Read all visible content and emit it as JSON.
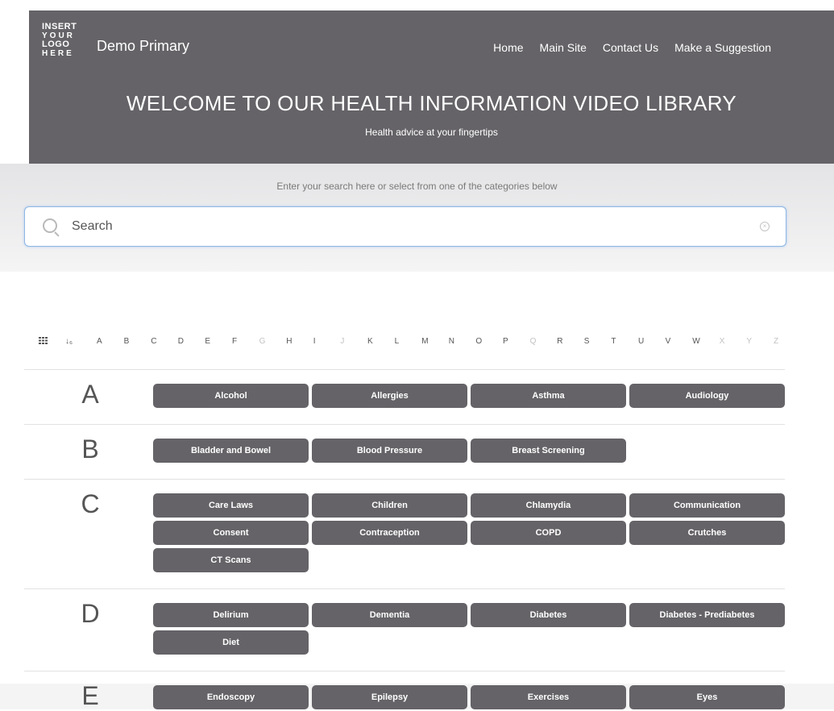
{
  "header": {
    "logo_lines": [
      "INSERT",
      "YOUR",
      "LOGO",
      "HERE"
    ],
    "site_name": "Demo Primary",
    "nav": [
      "Home",
      "Main Site",
      "Contact Us",
      "Make a Suggestion"
    ],
    "title": "WELCOME TO OUR HEALTH INFORMATION VIDEO LIBRARY",
    "subtitle": "Health advice at your fingertips"
  },
  "search": {
    "hint": "Enter your search here or select from one of the categories below",
    "placeholder": "Search",
    "value": ""
  },
  "alphabet": {
    "letters": [
      "A",
      "B",
      "C",
      "D",
      "E",
      "F",
      "G",
      "H",
      "I",
      "J",
      "K",
      "L",
      "M",
      "N",
      "O",
      "P",
      "Q",
      "R",
      "S",
      "T",
      "U",
      "V",
      "W",
      "X",
      "Y",
      "Z"
    ],
    "disabled": [
      "G",
      "J",
      "Q",
      "X",
      "Y",
      "Z"
    ]
  },
  "groups": [
    {
      "letter": "A",
      "items": [
        "Alcohol",
        "Allergies",
        "Asthma",
        "Audiology"
      ]
    },
    {
      "letter": "B",
      "items": [
        "Bladder and Bowel",
        "Blood Pressure",
        "Breast Screening"
      ]
    },
    {
      "letter": "C",
      "items": [
        "Care Laws",
        "Children",
        "Chlamydia",
        "Communication",
        "Consent",
        "Contraception",
        "COPD",
        "Crutches",
        "CT Scans"
      ]
    },
    {
      "letter": "D",
      "items": [
        "Delirium",
        "Dementia",
        "Diabetes",
        "Diabetes - Prediabetes",
        "Diet"
      ]
    },
    {
      "letter": "E",
      "items": [
        "Endoscopy",
        "Epilepsy",
        "Exercises",
        "Eyes"
      ]
    }
  ],
  "colors": {
    "header_bg": "#656367",
    "pill_bg": "#656367",
    "search_border": "#8fb6e3"
  }
}
